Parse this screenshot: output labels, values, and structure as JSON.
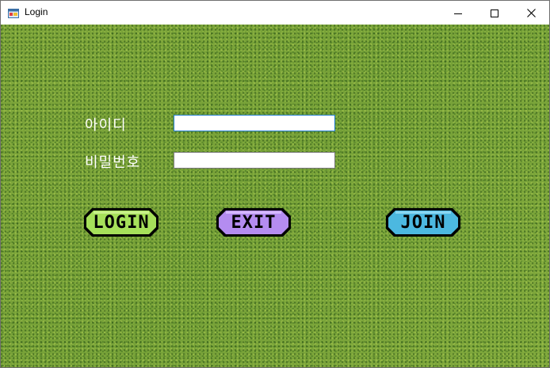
{
  "window": {
    "title": "Login"
  },
  "form": {
    "id_label": "아이디",
    "id_value": "",
    "pw_label": "비밀번호",
    "pw_value": ""
  },
  "buttons": {
    "login": "LOGIN",
    "exit": "EXIT",
    "join": "JOIN"
  },
  "colors": {
    "background": "#7aa43a",
    "login_button": "#a6e05a",
    "exit_button": "#b48cf0",
    "join_button": "#4cb8e0"
  },
  "icons": {
    "app": "app-icon",
    "minimize": "minimize-icon",
    "maximize": "maximize-icon",
    "close": "close-icon"
  }
}
